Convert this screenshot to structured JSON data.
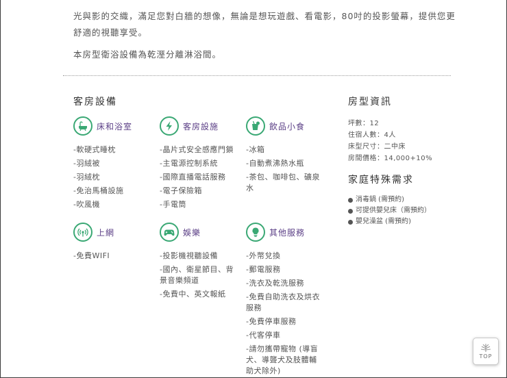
{
  "intro": {
    "para1": "光與影的交織，滿足您對白牆的想像，無論是想玩遊戲、看電影，80吋的投影螢幕，提供您更舒適的視聽享受。",
    "para2": "本房型衛浴設備為乾溼分離淋浴間。"
  },
  "facilities": {
    "title": "客房設備",
    "categories": [
      {
        "label": "床和浴室",
        "icon": "bathtub-icon",
        "items": [
          "-軟硬式睡枕",
          "-羽絨被",
          "-羽絨枕",
          "-免治馬桶設施",
          "-吹風機"
        ]
      },
      {
        "label": "客房設施",
        "icon": "lightning-icon",
        "items": [
          "-晶片式安全感應門鎖",
          "-主電源控制系統",
          "-國際直播電話服務",
          "-電子保險箱",
          "-手電筒"
        ]
      },
      {
        "label": "飲品小食",
        "icon": "drink-icon",
        "items": [
          "-冰箱",
          "-自動煮沸熱水瓶",
          "-茶包、咖啡包、礦泉水"
        ]
      },
      {
        "label": "上網",
        "icon": "wifi-icon",
        "items": [
          "-免費WIFI"
        ]
      },
      {
        "label": "娛樂",
        "icon": "gamepad-icon",
        "items": [
          "-投影機視聽設備",
          "-國內、衛星節目、背景音樂頻道",
          "-免費中、英文報紙"
        ]
      },
      {
        "label": "其他服務",
        "icon": "lightbulb-icon",
        "items": [
          "-外幣兌換",
          "-郵電服務",
          "-洗衣及乾洗服務",
          "-免費自助洗衣及烘衣服務",
          "-免費停車服務",
          "-代客停車",
          "-請勿攜帶寵物 (導盲犬、導聾犬及肢體輔助犬除外)"
        ]
      }
    ]
  },
  "room_info": {
    "title": "房型資訊",
    "lines": [
      "坪數：12",
      "住宿人數：4人",
      "床型尺寸：二中床",
      "房間價格：14,000+10%"
    ]
  },
  "family": {
    "title": "家庭特殊需求",
    "items": [
      "消毒鍋 (需預約)",
      "可提供嬰兒床（需預約）",
      "嬰兒澡盆 (需預約)"
    ]
  },
  "top_button": {
    "label": "TOP"
  },
  "colors": {
    "accent_green": "#3aa874",
    "label_purple": "#5b3f86"
  }
}
